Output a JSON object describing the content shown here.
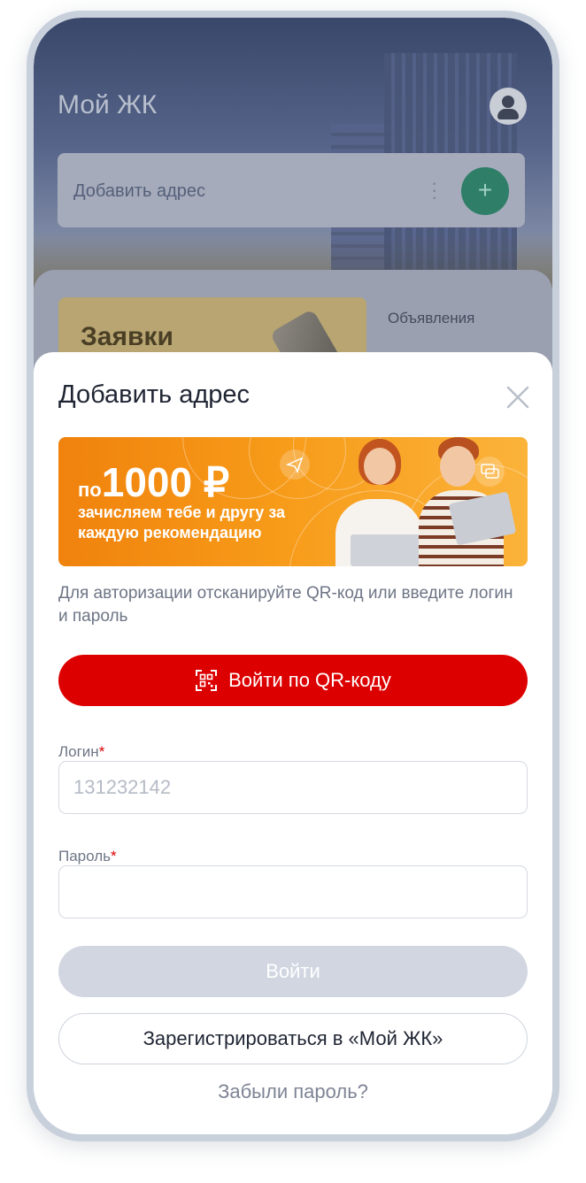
{
  "background_app": {
    "title": "Мой ЖК",
    "address_placeholder": "Добавить адрес",
    "card_title": "Заявки",
    "announcements_label": "Объявления"
  },
  "sheet": {
    "title": "Добавить адрес",
    "banner": {
      "prefix": "по",
      "amount": "1000 ₽",
      "subtitle": "зачисляем тебе и другу за каждую рекомендацию"
    },
    "hint": "Для авторизации отсканируйте QR-код или введите логин и пароль",
    "qr_button_label": "Войти по QR-коду",
    "login": {
      "label": "Логин",
      "required_mark": "*",
      "placeholder": "131232142",
      "value": ""
    },
    "password": {
      "label": "Пароль",
      "required_mark": "*",
      "value": ""
    },
    "submit_label": "Войти",
    "register_label": "Зарегистрироваться в «Мой ЖК»",
    "forgot_label": "Забыли пароль?"
  },
  "colors": {
    "primary_red": "#dd0000",
    "disabled": "#d1d6e1",
    "banner_orange": "#f79a18",
    "add_button_green": "#2f7e68"
  }
}
